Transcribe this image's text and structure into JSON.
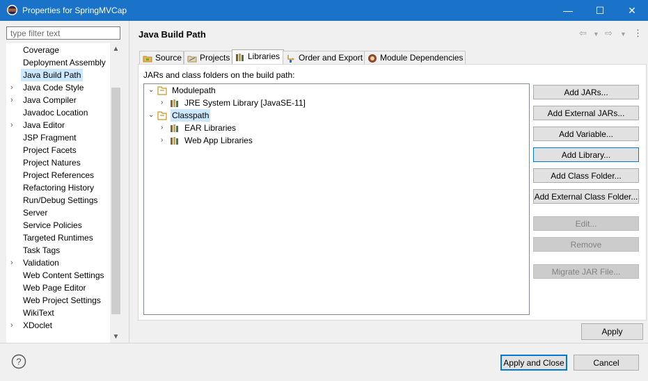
{
  "window": {
    "title": "Properties for SpringMVCap",
    "minimize": "—",
    "maximize": "☐",
    "close": "✕"
  },
  "filter": {
    "placeholder": "type filter text",
    "value": ""
  },
  "nav": {
    "items": [
      {
        "label": "Coverage",
        "expandable": false
      },
      {
        "label": "Deployment Assembly",
        "expandable": false
      },
      {
        "label": "Java Build Path",
        "expandable": false,
        "selected": true
      },
      {
        "label": "Java Code Style",
        "expandable": true
      },
      {
        "label": "Java Compiler",
        "expandable": true
      },
      {
        "label": "Javadoc Location",
        "expandable": false
      },
      {
        "label": "Java Editor",
        "expandable": true
      },
      {
        "label": "JSP Fragment",
        "expandable": false
      },
      {
        "label": "Project Facets",
        "expandable": false
      },
      {
        "label": "Project Natures",
        "expandable": false
      },
      {
        "label": "Project References",
        "expandable": false
      },
      {
        "label": "Refactoring History",
        "expandable": false
      },
      {
        "label": "Run/Debug Settings",
        "expandable": false
      },
      {
        "label": "Server",
        "expandable": false
      },
      {
        "label": "Service Policies",
        "expandable": false
      },
      {
        "label": "Targeted Runtimes",
        "expandable": false
      },
      {
        "label": "Task Tags",
        "expandable": false
      },
      {
        "label": "Validation",
        "expandable": true
      },
      {
        "label": "Web Content Settings",
        "expandable": false
      },
      {
        "label": "Web Page Editor",
        "expandable": false
      },
      {
        "label": "Web Project Settings",
        "expandable": false
      },
      {
        "label": "WikiText",
        "expandable": false
      },
      {
        "label": "XDoclet",
        "expandable": true
      }
    ]
  },
  "page": {
    "title": "Java Build Path",
    "tabs": [
      {
        "label": "Source",
        "icon": "source-folder-icon"
      },
      {
        "label": "Projects",
        "icon": "projects-icon"
      },
      {
        "label": "Libraries",
        "icon": "libraries-icon",
        "active": true
      },
      {
        "label": "Order and Export",
        "icon": "order-export-icon"
      },
      {
        "label": "Module Dependencies",
        "icon": "module-icon"
      }
    ],
    "panel_label": "JARs and class folders on the build path:",
    "tree": [
      {
        "label": "Modulepath",
        "level": 0,
        "expanded": true,
        "icon": "classpath-container-icon"
      },
      {
        "label": "JRE System Library [JavaSE-11]",
        "level": 1,
        "expanded": false,
        "icon": "library-icon"
      },
      {
        "label": "Classpath",
        "level": 0,
        "expanded": true,
        "icon": "classpath-container-icon",
        "selected": true
      },
      {
        "label": "EAR Libraries",
        "level": 1,
        "expanded": false,
        "icon": "library-icon"
      },
      {
        "label": "Web App Libraries",
        "level": 1,
        "expanded": false,
        "icon": "library-icon"
      }
    ],
    "buttons": {
      "add_jars": "Add JARs...",
      "add_external_jars": "Add External JARs...",
      "add_variable": "Add Variable...",
      "add_library": "Add Library...",
      "add_class_folder": "Add Class Folder...",
      "add_external_class_folder": "Add External Class Folder...",
      "edit": "Edit...",
      "remove": "Remove",
      "migrate_jar": "Migrate JAR File..."
    },
    "apply": "Apply"
  },
  "footer": {
    "apply_and_close": "Apply and Close",
    "cancel": "Cancel"
  },
  "colors": {
    "titlebar": "#1a73c8",
    "selection": "#cce8ff",
    "focus_border": "#0078d7"
  }
}
